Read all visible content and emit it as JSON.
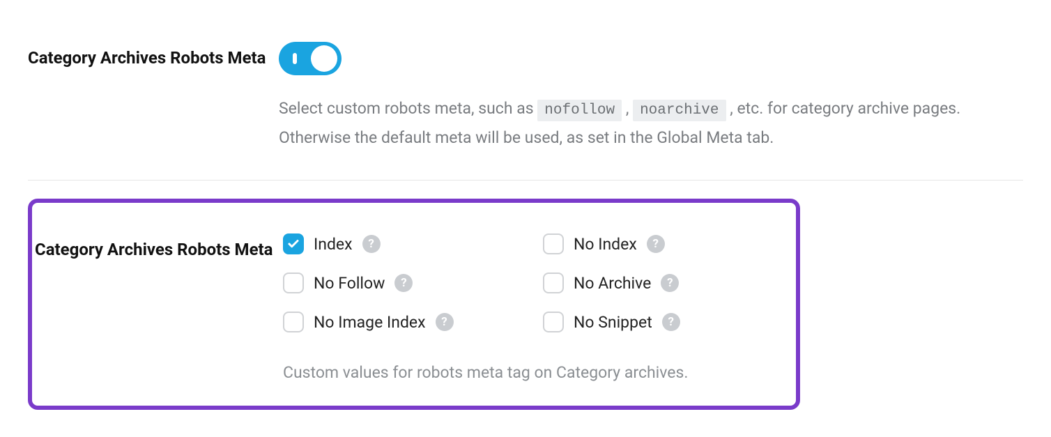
{
  "section1": {
    "title": "Category Archives Robots Meta",
    "desc_part1": "Select custom robots meta, such as ",
    "code1": "nofollow",
    "desc_mid": ", ",
    "code2": "noarchive",
    "desc_part2": ", etc. for category archive pages. Otherwise the default meta will be used, as set in the Global Meta tab."
  },
  "section2": {
    "title": "Category Archives Robots Meta",
    "options": [
      {
        "label": "Index",
        "checked": true
      },
      {
        "label": "No Index",
        "checked": false
      },
      {
        "label": "No Follow",
        "checked": false
      },
      {
        "label": "No Archive",
        "checked": false
      },
      {
        "label": "No Image Index",
        "checked": false
      },
      {
        "label": "No Snippet",
        "checked": false
      }
    ],
    "desc": "Custom values for robots meta tag on Category archives."
  },
  "icons": {
    "help": "?"
  }
}
